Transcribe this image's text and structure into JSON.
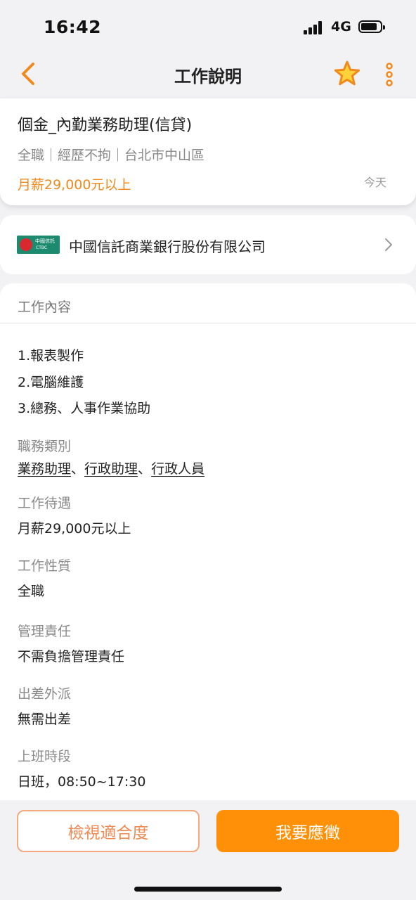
{
  "status_bar": {
    "time": "16:42",
    "network": "4G"
  },
  "nav": {
    "title": "工作說明",
    "back_icon": "chevron-left-icon",
    "favorite_icon": "star-icon",
    "more_icon": "more-vertical-icon"
  },
  "colors": {
    "accent": "#FF9008",
    "salary_text": "#F08A1C",
    "logo_green": "#1B8A6F",
    "logo_red": "#D9282F"
  },
  "job": {
    "title": "個金_內勤業務助理(信貸)",
    "meta": "全職｜經歷不拘｜台北市中山區",
    "salary": "月薪29,000元以上",
    "posted": "今天"
  },
  "company": {
    "name": "中國信託商業銀行股份有限公司",
    "logo_text_zh": "中國信託",
    "logo_text_en": "CTBC"
  },
  "details": {
    "section_title": "工作內容",
    "duties": [
      "1.報表製作",
      "2.電腦維護",
      "3.總務、人事作業協助"
    ],
    "category_label": "職務類別",
    "categories": [
      "業務助理",
      "行政助理",
      "行政人員"
    ],
    "category_separator": "、",
    "fields": [
      {
        "label": "工作待遇",
        "value": "月薪29,000元以上"
      },
      {
        "label": "工作性質",
        "value": "全職"
      },
      {
        "label": "管理責任",
        "value": "不需負擔管理責任"
      },
      {
        "label": "出差外派",
        "value": "無需出差"
      },
      {
        "label": "上班時段",
        "value": "日班，08:50~17:30"
      }
    ]
  },
  "actions": {
    "fit_check": "檢視適合度",
    "apply": "我要應徵"
  }
}
